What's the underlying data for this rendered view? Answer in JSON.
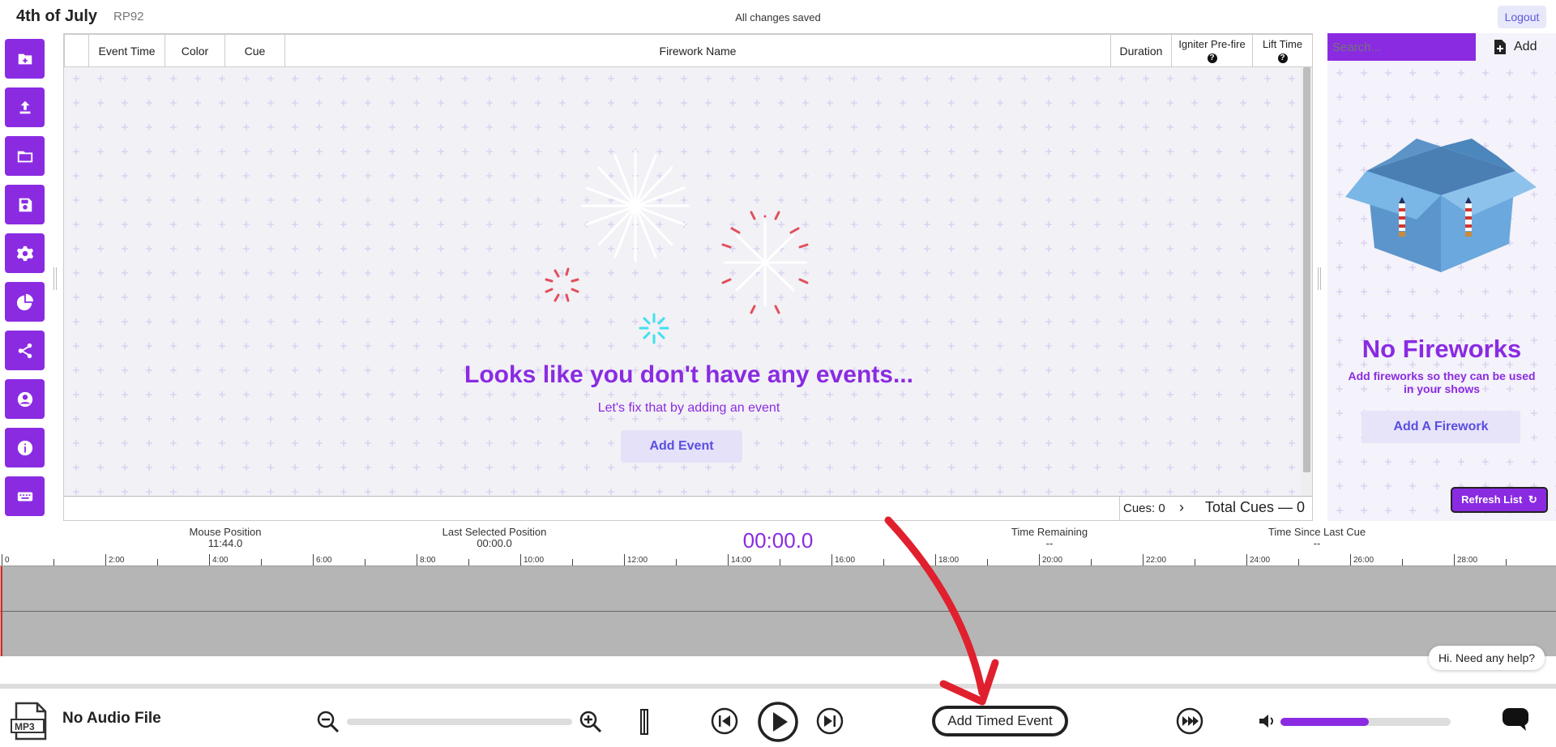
{
  "header": {
    "title": "4th of July",
    "code": "RP92",
    "status": "All changes saved",
    "logout": "Logout"
  },
  "sidebar": {
    "items": [
      {
        "name": "new-show-icon"
      },
      {
        "name": "upload-icon"
      },
      {
        "name": "folder-icon"
      },
      {
        "name": "save-icon"
      },
      {
        "name": "gear-icon"
      },
      {
        "name": "pie-chart-icon"
      },
      {
        "name": "share-icon"
      },
      {
        "name": "account-icon"
      },
      {
        "name": "info-icon"
      },
      {
        "name": "keyboard-icon"
      }
    ]
  },
  "events_table": {
    "columns": [
      "Event Time",
      "Color",
      "Cue",
      "Firework Name",
      "Duration",
      "Igniter Pre-fire",
      "Lift Time"
    ],
    "help_mark": "?",
    "empty_title": "Looks like you don't have any events...",
    "empty_subtitle": "Let's fix that by adding an event",
    "add_event": "Add Event",
    "cues_label": "Cues: 0",
    "total_cues": "Total Cues — 0",
    "chevron": "›"
  },
  "fireworks_panel": {
    "search_placeholder": "Search...",
    "add_label": "Add",
    "empty_title": "No Fireworks",
    "empty_subtitle": "Add fireworks so they can be used in your shows",
    "add_button": "Add A Firework",
    "refresh_button": "Refresh List"
  },
  "timeline": {
    "mouse_position_label": "Mouse Position",
    "mouse_position_value": "11:44.0",
    "last_selected_label": "Last Selected Position",
    "last_selected_value": "00:00.0",
    "timer": "00:00.0",
    "time_remaining_label": "Time Remaining",
    "time_remaining_value": "--",
    "since_last_cue_label": "Time Since Last Cue",
    "since_last_cue_value": "--",
    "ticks": [
      "0",
      "2:00",
      "4:00",
      "6:00",
      "8:00",
      "10:00",
      "12:00",
      "14:00",
      "16:00",
      "18:00",
      "20:00",
      "22:00",
      "24:00",
      "26:00",
      "28:00"
    ]
  },
  "player": {
    "mp3_label": "MP3",
    "audio_label": "No Audio File",
    "add_timed_event": "Add Timed Event",
    "volume_level_percent": 52
  },
  "chat": {
    "bubble": "Hi. Need any help?"
  },
  "colors": {
    "accent": "#8a2be2",
    "annotation_arrow": "#e0202e"
  }
}
